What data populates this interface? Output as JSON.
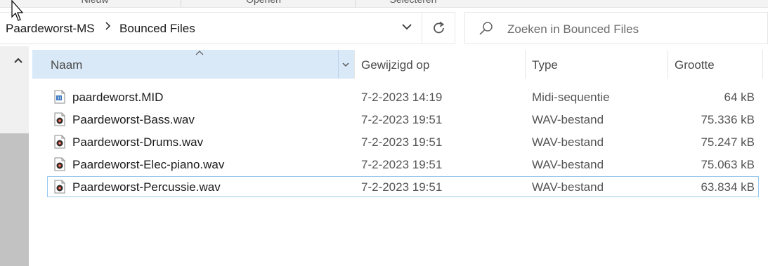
{
  "ribbon": {
    "groups": [
      "Nieuw",
      "Openen",
      "Selecteren"
    ]
  },
  "address": {
    "breadcrumb": [
      "Paardeworst-MS",
      "Bounced Files"
    ]
  },
  "search": {
    "placeholder": "Zoeken in Bounced Files"
  },
  "columns": {
    "name": "Naam",
    "modified": "Gewijzigd op",
    "type": "Type",
    "size": "Grootte"
  },
  "files": [
    {
      "name": "paardeworst.MID",
      "modified": "7-2-2023 14:19",
      "type": "Midi-sequentie",
      "size": "64 kB",
      "icon": "midi-file-icon"
    },
    {
      "name": "Paardeworst-Bass.wav",
      "modified": "7-2-2023 19:51",
      "type": "WAV-bestand",
      "size": "75.336 kB",
      "icon": "wav-file-icon"
    },
    {
      "name": "Paardeworst-Drums.wav",
      "modified": "7-2-2023 19:51",
      "type": "WAV-bestand",
      "size": "75.247 kB",
      "icon": "wav-file-icon"
    },
    {
      "name": "Paardeworst-Elec-piano.wav",
      "modified": "7-2-2023 19:51",
      "type": "WAV-bestand",
      "size": "75.063 kB",
      "icon": "wav-file-icon"
    },
    {
      "name": "Paardeworst-Percussie.wav",
      "modified": "7-2-2023 19:51",
      "type": "WAV-bestand",
      "size": "63.834 kB",
      "icon": "wav-file-icon",
      "selected": true
    }
  ],
  "colors": {
    "header_highlight": "#d9e9f7",
    "selection_border": "#99c9ef",
    "scroll_thumb": "#c2c2c2"
  }
}
